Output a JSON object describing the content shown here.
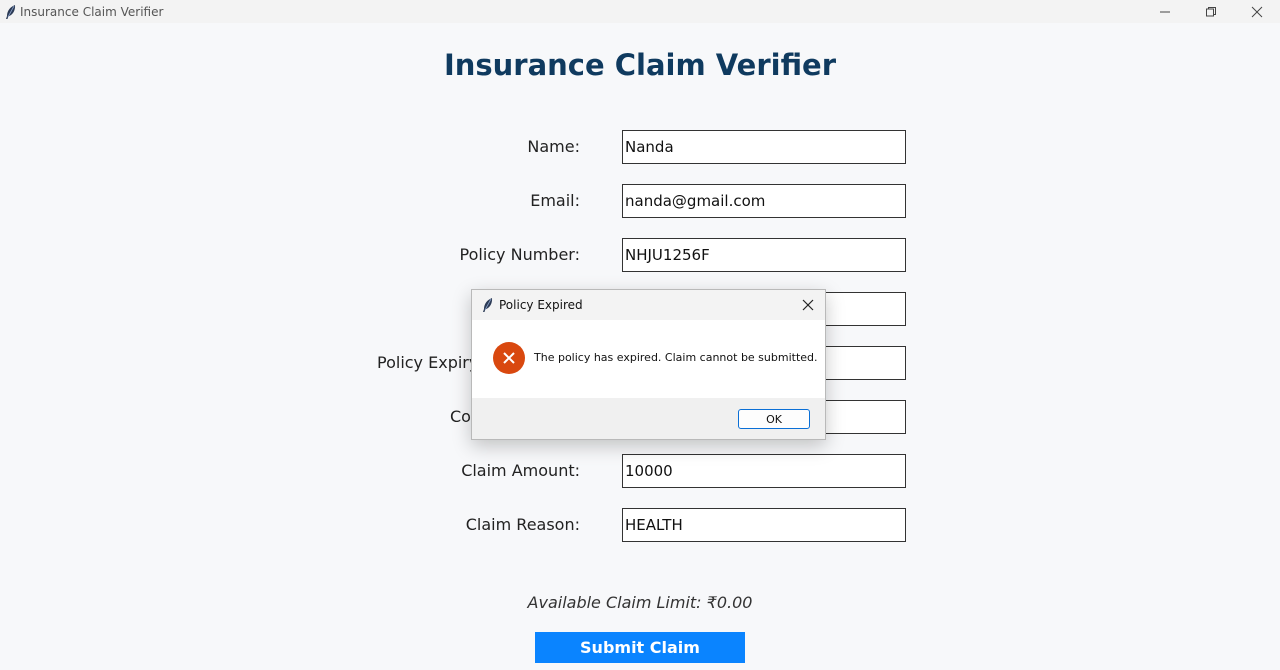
{
  "window": {
    "title": "Insurance Claim Verifier",
    "controls": [
      "minimize-icon",
      "restore-icon",
      "close-icon"
    ]
  },
  "main": {
    "heading": "Insurance Claim Verifier",
    "form": {
      "name_label": "Name:",
      "name_value": "Nanda",
      "email_label": "Email:",
      "email_value": "nanda@gmail.com",
      "policy_number_label": "Policy Number:",
      "policy_number_value": "NHJU1256F",
      "policy_expiry_label": "Policy Expiry (",
      "coverage_label": "Co",
      "claim_amount_label": "Claim Amount:",
      "claim_amount_value": "10000",
      "claim_reason_label": "Claim Reason:",
      "claim_reason_value": "HEALTH"
    },
    "available_limit": "Available Claim Limit: ₹0.00",
    "submit_label": "Submit Claim"
  },
  "dialog": {
    "title": "Policy Expired",
    "message": "The policy has expired. Claim cannot be submitted.",
    "ok_label": "OK",
    "icon": "error-icon"
  },
  "colors": {
    "heading": "#0f3a5f",
    "submit_bg": "#0a84ff",
    "error_icon": "#d9480f",
    "ok_border": "#0a6fd6"
  }
}
